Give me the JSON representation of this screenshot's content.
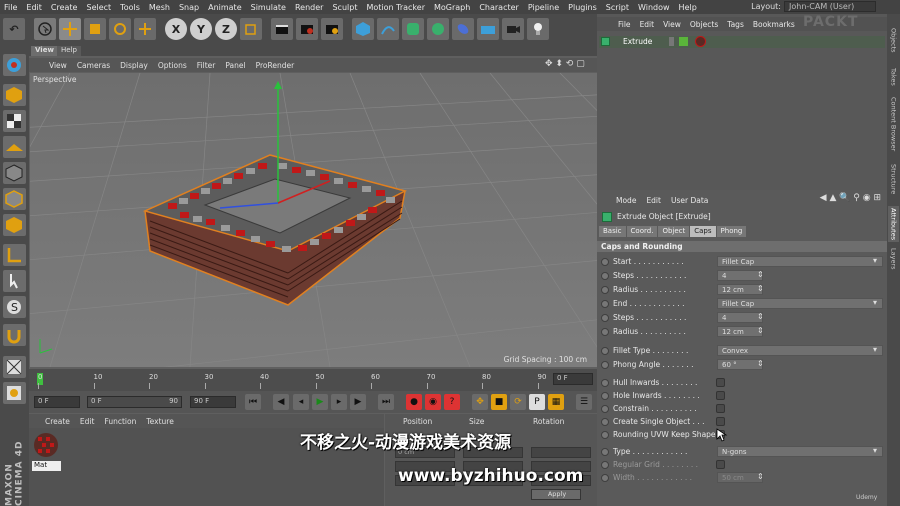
{
  "menubar": {
    "items": [
      "File",
      "Edit",
      "Create",
      "Select",
      "Tools",
      "Mesh",
      "Snap",
      "Animate",
      "Simulate",
      "Render",
      "Sculpt",
      "Motion Tracker",
      "MoGraph",
      "Character",
      "Pipeline",
      "Plugins",
      "Script",
      "Window",
      "Help"
    ],
    "layout_label": "Layout:",
    "layout_value": "John-CAM (User)"
  },
  "toolbar": {
    "axis_x": "X",
    "axis_y": "Y",
    "axis_z": "Z"
  },
  "viewport": {
    "tabs": [
      "View",
      "Help"
    ],
    "menu": [
      "View",
      "Cameras",
      "Display",
      "Options",
      "Filter",
      "Panel",
      "ProRender"
    ],
    "label": "Perspective",
    "grid_spacing": "Grid Spacing : 100 cm"
  },
  "timeline": {
    "ticks": [
      "0",
      "10",
      "20",
      "30",
      "40",
      "50",
      "60",
      "70",
      "80",
      "90"
    ],
    "current_frame": "0 F"
  },
  "transport": {
    "start": "0 F",
    "min": "0 F",
    "max": "90 F",
    "end": "90 F",
    "slider_end": "90"
  },
  "material_manager": {
    "menu": [
      "Create",
      "Edit",
      "Function",
      "Texture"
    ],
    "material_name": "Mat"
  },
  "coordinates": {
    "headers": [
      "Position",
      "Size",
      "Rotation"
    ],
    "pos_x": "0 cm",
    "apply": "Apply"
  },
  "object_manager": {
    "menu": [
      "File",
      "Edit",
      "View",
      "Objects",
      "Tags",
      "Bookmarks"
    ],
    "object_name": "Extrude"
  },
  "attribute_manager": {
    "menu": [
      "Mode",
      "Edit",
      "User Data"
    ],
    "title": "Extrude Object [Extrude]",
    "tabs": [
      "Basic",
      "Coord.",
      "Object",
      "Caps",
      "Phong"
    ],
    "active_tab": "Caps",
    "section": "Caps and Rounding",
    "rows": [
      {
        "label": "Start . . . . . . . . . . .",
        "value": "Fillet Cap",
        "kind": "dropdown"
      },
      {
        "label": "Steps . . . . . . . . . . .",
        "value": "4",
        "kind": "number"
      },
      {
        "label": "Radius . . . . . . . . . .",
        "value": "12 cm",
        "kind": "number"
      },
      {
        "label": "End . . . . . . . . . . . .",
        "value": "Fillet Cap",
        "kind": "dropdown"
      },
      {
        "label": "Steps . . . . . . . . . . .",
        "value": "4",
        "kind": "number"
      },
      {
        "label": "Radius . . . . . . . . . .",
        "value": "12 cm",
        "kind": "number"
      },
      {
        "label": "Fillet Type . . . . . . . .",
        "value": "Convex",
        "kind": "dropdown"
      },
      {
        "label": "Phong Angle . . . . . . .",
        "value": "60 °",
        "kind": "number"
      },
      {
        "label": "Hull Inwards . . . . . . . .",
        "value": "",
        "kind": "check"
      },
      {
        "label": "Hole Inwards . . . . . . . .",
        "value": "",
        "kind": "check"
      },
      {
        "label": "Constrain . . . . . . . . . .",
        "value": "",
        "kind": "check"
      },
      {
        "label": "Create Single Object . . .",
        "value": "",
        "kind": "check"
      },
      {
        "label": "Rounding UVW Keep Shape",
        "value": "",
        "kind": "check"
      },
      {
        "label": "Type . . . . . . . . . . . .",
        "value": "N-gons",
        "kind": "dropdown"
      },
      {
        "label": "Regular Grid . . . . . . . .",
        "value": "",
        "kind": "check-dim"
      },
      {
        "label": "Width . . . . . . . . . . . .",
        "value": "50 cm",
        "kind": "number-dim"
      }
    ]
  },
  "right_tabs": [
    "Objects",
    "Takes",
    "Content Browser",
    "Structure",
    "Attributes",
    "Layers"
  ],
  "brand": "MAXON CINEMA 4D",
  "overlay": {
    "watermark_cn": "不移之火-动漫游戏美术资源",
    "watermark_url": "www.byzhihuo.com",
    "packt": "PACKT",
    "udemy": "Udemy"
  }
}
